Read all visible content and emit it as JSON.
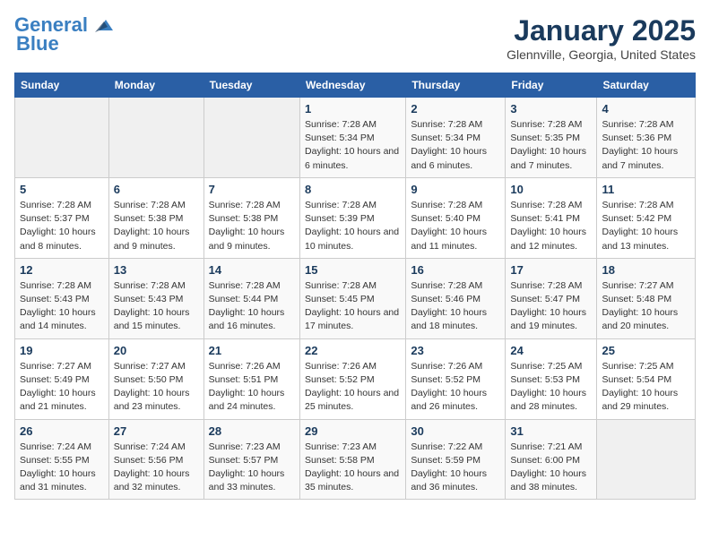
{
  "header": {
    "logo_line1": "General",
    "logo_line2": "Blue",
    "title": "January 2025",
    "subtitle": "Glennville, Georgia, United States"
  },
  "weekdays": [
    "Sunday",
    "Monday",
    "Tuesday",
    "Wednesday",
    "Thursday",
    "Friday",
    "Saturday"
  ],
  "weeks": [
    [
      {
        "day": "",
        "empty": true
      },
      {
        "day": "",
        "empty": true
      },
      {
        "day": "",
        "empty": true
      },
      {
        "day": "1",
        "sunrise": "7:28 AM",
        "sunset": "5:34 PM",
        "daylight": "10 hours and 6 minutes."
      },
      {
        "day": "2",
        "sunrise": "7:28 AM",
        "sunset": "5:34 PM",
        "daylight": "10 hours and 6 minutes."
      },
      {
        "day": "3",
        "sunrise": "7:28 AM",
        "sunset": "5:35 PM",
        "daylight": "10 hours and 7 minutes."
      },
      {
        "day": "4",
        "sunrise": "7:28 AM",
        "sunset": "5:36 PM",
        "daylight": "10 hours and 7 minutes."
      }
    ],
    [
      {
        "day": "5",
        "sunrise": "7:28 AM",
        "sunset": "5:37 PM",
        "daylight": "10 hours and 8 minutes."
      },
      {
        "day": "6",
        "sunrise": "7:28 AM",
        "sunset": "5:38 PM",
        "daylight": "10 hours and 9 minutes."
      },
      {
        "day": "7",
        "sunrise": "7:28 AM",
        "sunset": "5:38 PM",
        "daylight": "10 hours and 9 minutes."
      },
      {
        "day": "8",
        "sunrise": "7:28 AM",
        "sunset": "5:39 PM",
        "daylight": "10 hours and 10 minutes."
      },
      {
        "day": "9",
        "sunrise": "7:28 AM",
        "sunset": "5:40 PM",
        "daylight": "10 hours and 11 minutes."
      },
      {
        "day": "10",
        "sunrise": "7:28 AM",
        "sunset": "5:41 PM",
        "daylight": "10 hours and 12 minutes."
      },
      {
        "day": "11",
        "sunrise": "7:28 AM",
        "sunset": "5:42 PM",
        "daylight": "10 hours and 13 minutes."
      }
    ],
    [
      {
        "day": "12",
        "sunrise": "7:28 AM",
        "sunset": "5:43 PM",
        "daylight": "10 hours and 14 minutes."
      },
      {
        "day": "13",
        "sunrise": "7:28 AM",
        "sunset": "5:43 PM",
        "daylight": "10 hours and 15 minutes."
      },
      {
        "day": "14",
        "sunrise": "7:28 AM",
        "sunset": "5:44 PM",
        "daylight": "10 hours and 16 minutes."
      },
      {
        "day": "15",
        "sunrise": "7:28 AM",
        "sunset": "5:45 PM",
        "daylight": "10 hours and 17 minutes."
      },
      {
        "day": "16",
        "sunrise": "7:28 AM",
        "sunset": "5:46 PM",
        "daylight": "10 hours and 18 minutes."
      },
      {
        "day": "17",
        "sunrise": "7:28 AM",
        "sunset": "5:47 PM",
        "daylight": "10 hours and 19 minutes."
      },
      {
        "day": "18",
        "sunrise": "7:27 AM",
        "sunset": "5:48 PM",
        "daylight": "10 hours and 20 minutes."
      }
    ],
    [
      {
        "day": "19",
        "sunrise": "7:27 AM",
        "sunset": "5:49 PM",
        "daylight": "10 hours and 21 minutes."
      },
      {
        "day": "20",
        "sunrise": "7:27 AM",
        "sunset": "5:50 PM",
        "daylight": "10 hours and 23 minutes."
      },
      {
        "day": "21",
        "sunrise": "7:26 AM",
        "sunset": "5:51 PM",
        "daylight": "10 hours and 24 minutes."
      },
      {
        "day": "22",
        "sunrise": "7:26 AM",
        "sunset": "5:52 PM",
        "daylight": "10 hours and 25 minutes."
      },
      {
        "day": "23",
        "sunrise": "7:26 AM",
        "sunset": "5:52 PM",
        "daylight": "10 hours and 26 minutes."
      },
      {
        "day": "24",
        "sunrise": "7:25 AM",
        "sunset": "5:53 PM",
        "daylight": "10 hours and 28 minutes."
      },
      {
        "day": "25",
        "sunrise": "7:25 AM",
        "sunset": "5:54 PM",
        "daylight": "10 hours and 29 minutes."
      }
    ],
    [
      {
        "day": "26",
        "sunrise": "7:24 AM",
        "sunset": "5:55 PM",
        "daylight": "10 hours and 31 minutes."
      },
      {
        "day": "27",
        "sunrise": "7:24 AM",
        "sunset": "5:56 PM",
        "daylight": "10 hours and 32 minutes."
      },
      {
        "day": "28",
        "sunrise": "7:23 AM",
        "sunset": "5:57 PM",
        "daylight": "10 hours and 33 minutes."
      },
      {
        "day": "29",
        "sunrise": "7:23 AM",
        "sunset": "5:58 PM",
        "daylight": "10 hours and 35 minutes."
      },
      {
        "day": "30",
        "sunrise": "7:22 AM",
        "sunset": "5:59 PM",
        "daylight": "10 hours and 36 minutes."
      },
      {
        "day": "31",
        "sunrise": "7:21 AM",
        "sunset": "6:00 PM",
        "daylight": "10 hours and 38 minutes."
      },
      {
        "day": "",
        "empty": true
      }
    ]
  ],
  "labels": {
    "sunrise": "Sunrise:",
    "sunset": "Sunset:",
    "daylight": "Daylight:"
  }
}
